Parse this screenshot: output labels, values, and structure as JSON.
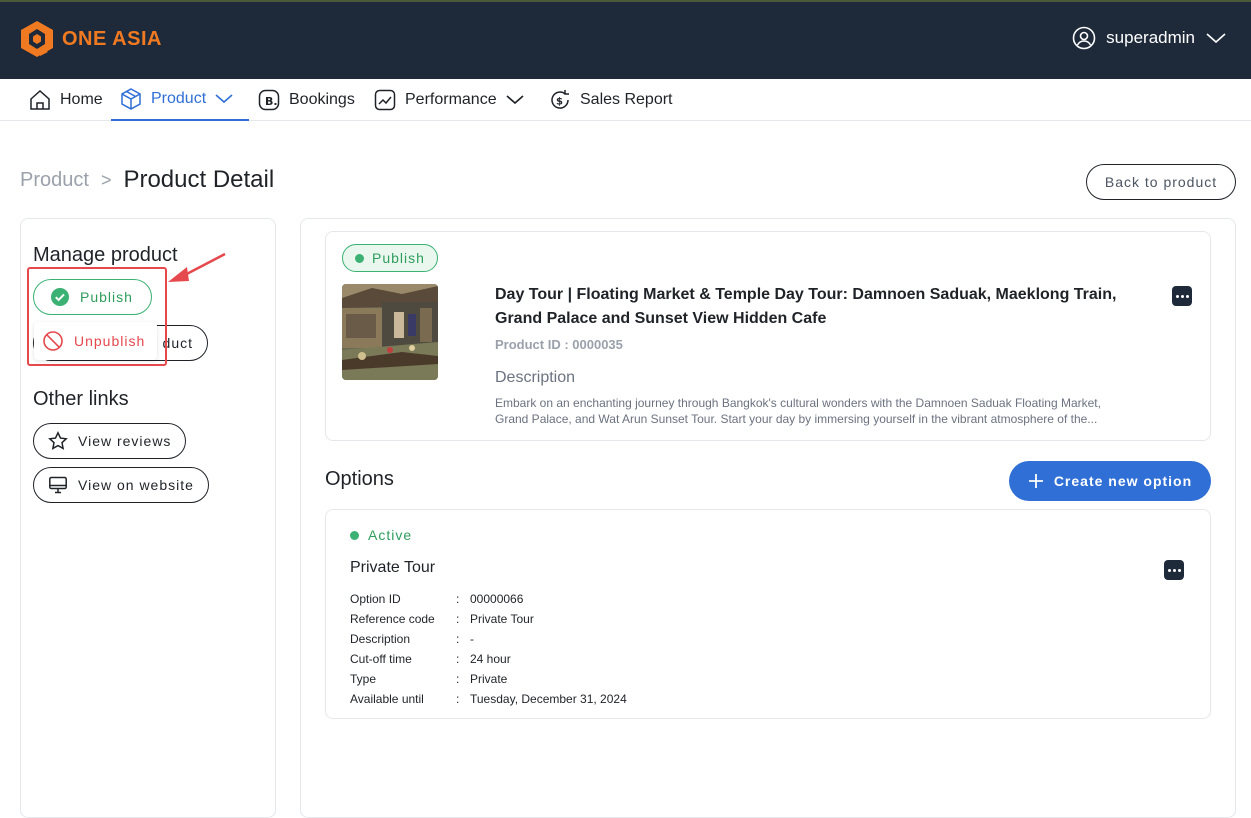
{
  "brand": {
    "name": "ONE ASIA",
    "accent": "#f07a22"
  },
  "header": {
    "username": "superadmin"
  },
  "nav": {
    "home": "Home",
    "product": "Product",
    "bookings": "Bookings",
    "performance": "Performance",
    "sales_report": "Sales Report"
  },
  "breadcrumb": {
    "parent": "Product",
    "separator": ">",
    "current": "Product Detail"
  },
  "back_button": "Back to product",
  "sidebar": {
    "manage_title": "Manage product",
    "status_menu": {
      "publish": "Publish",
      "unpublish": "Unpublish"
    },
    "behind_button_fragment": "duct",
    "other_links_title": "Other links",
    "view_reviews": "View reviews",
    "view_website": "View on website"
  },
  "product": {
    "status": "Publish",
    "title": "Day Tour | Floating Market & Temple Day Tour: Damnoen Saduak, Maeklong Train, Grand Palace and Sunset View Hidden Cafe",
    "id_label": "Product ID : 0000035",
    "description_heading": "Description",
    "description": "Embark on an enchanting journey through Bangkok's cultural wonders with the Damnoen Saduak Floating Market, Grand Palace, and Wat Arun Sunset Tour. Start your day by immersing yourself in the vibrant atmosphere of the..."
  },
  "options": {
    "heading": "Options",
    "create_button": "Create new option",
    "items": [
      {
        "status": "Active",
        "title": "Private Tour",
        "rows": [
          {
            "key": "Option ID",
            "value": "00000066"
          },
          {
            "key": "Reference code",
            "value": "Private Tour"
          },
          {
            "key": "Description",
            "value": "-"
          },
          {
            "key": "Cut-off time",
            "value": "24 hour"
          },
          {
            "key": "Type",
            "value": "Private"
          },
          {
            "key": "Available until",
            "value": "Tuesday, December 31, 2024"
          }
        ]
      }
    ]
  },
  "colors": {
    "primary": "#2f6fd6",
    "success": "#3bb273",
    "danger": "#e5484d",
    "header_bg": "#1e2a3a"
  }
}
